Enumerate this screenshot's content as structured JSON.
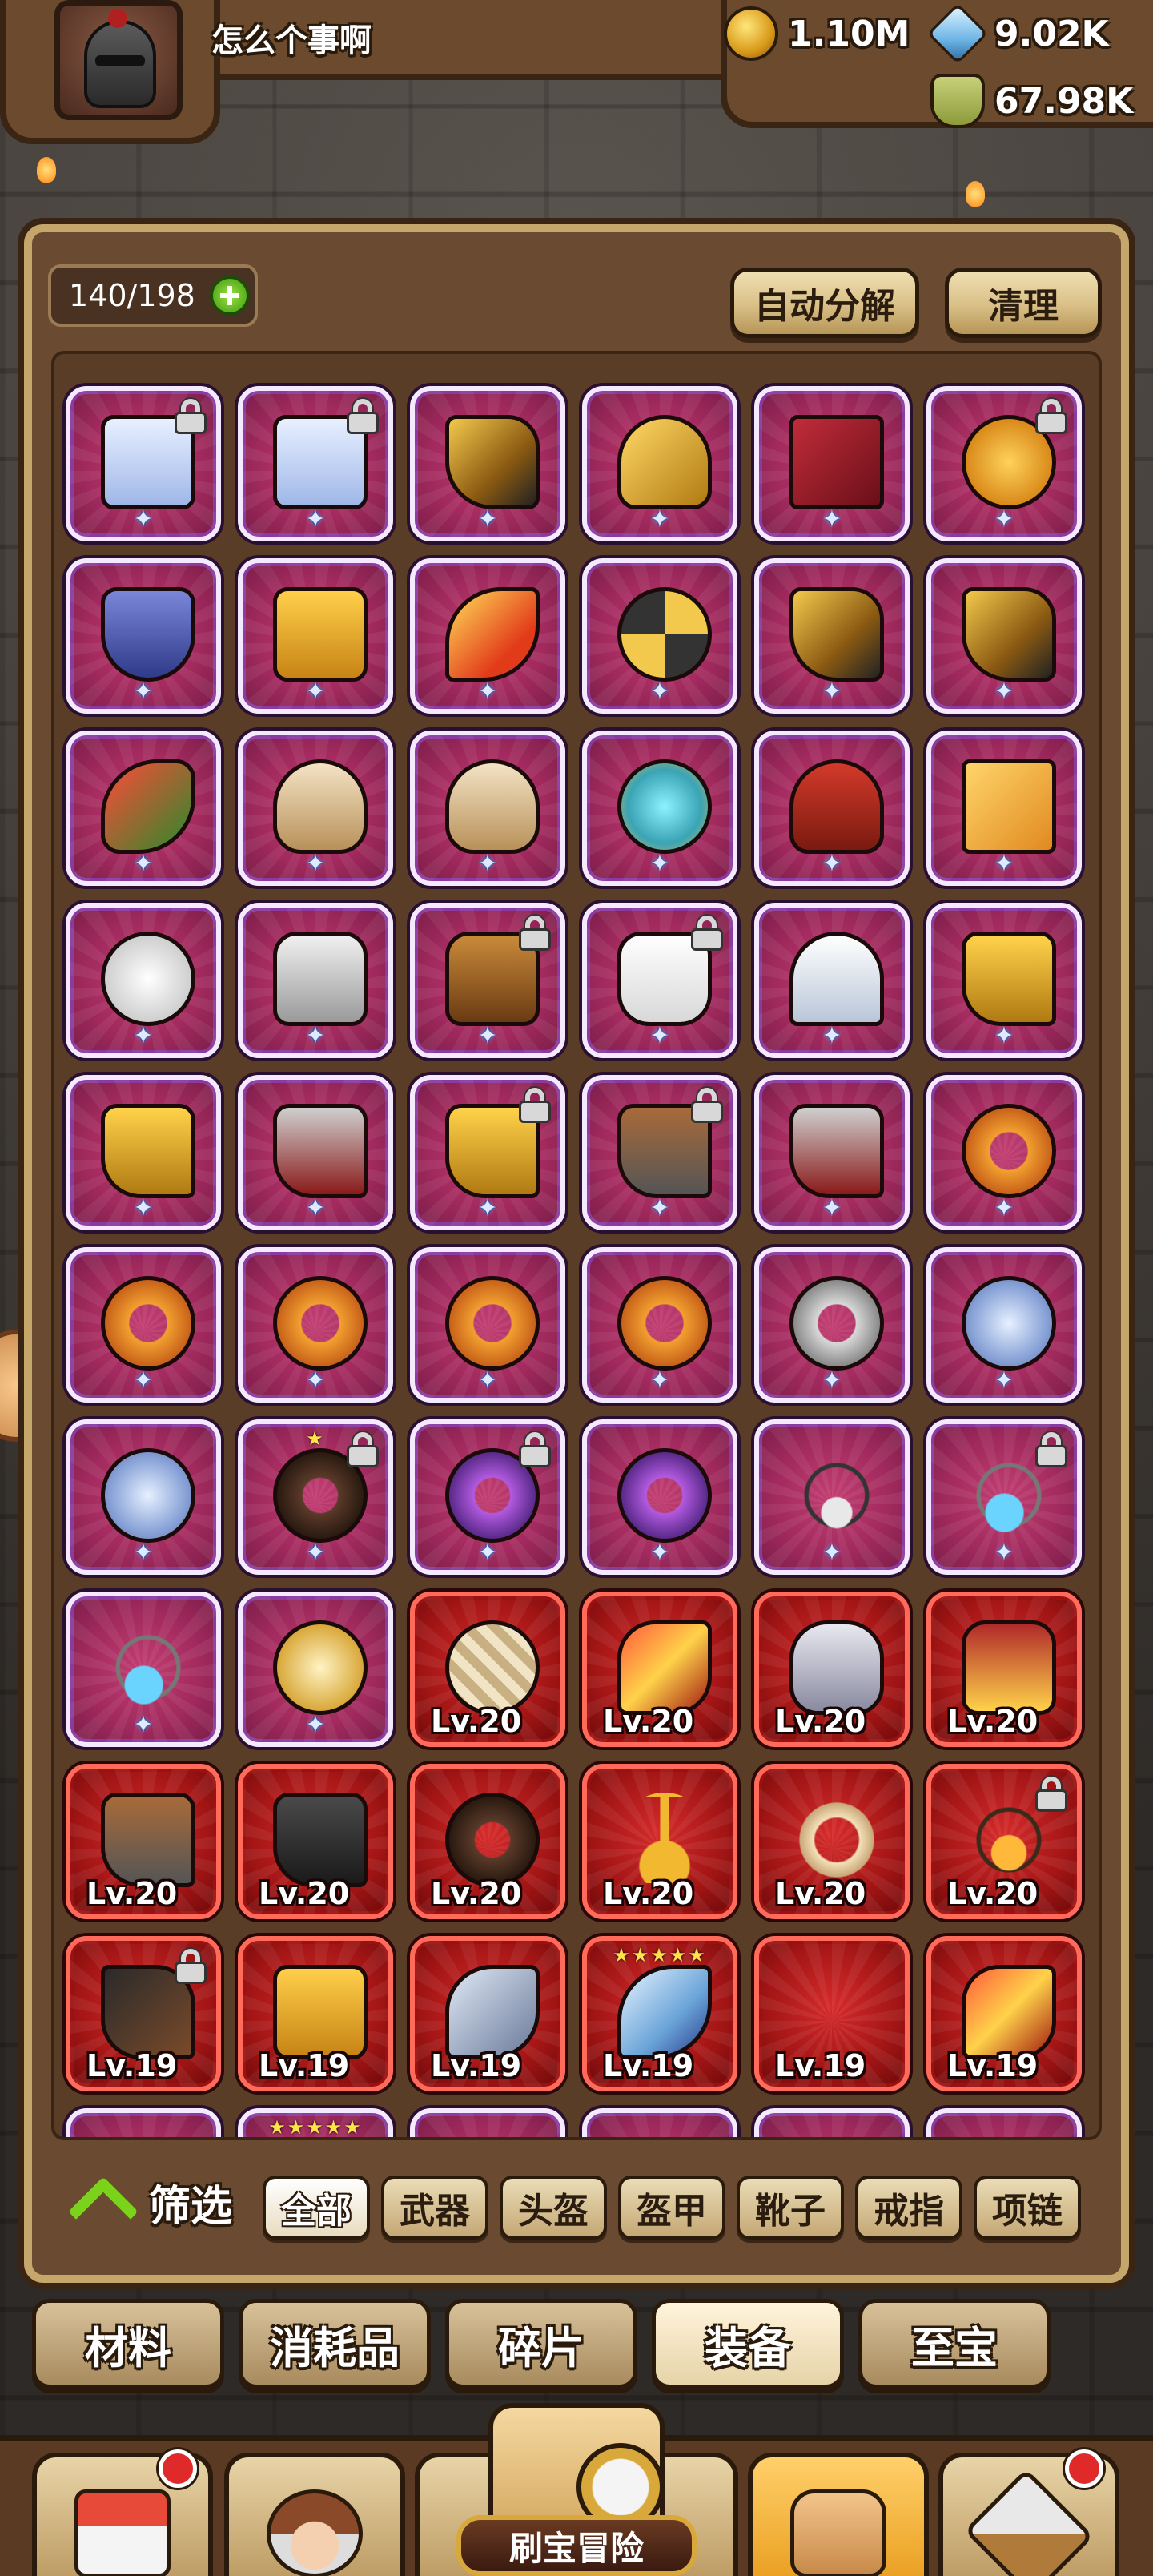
{
  "player": {
    "name": "怎么个事啊",
    "avatar_icon": "knight-helmet-icon"
  },
  "resources": [
    {
      "icon": "gold-coin-icon",
      "value": "1.10M"
    },
    {
      "icon": "diamond-icon",
      "value": "9.02K"
    },
    {
      "icon": "potion-icon",
      "value": "67.98K"
    }
  ],
  "inventory": {
    "capacity": "140/198",
    "auto_decompose_label": "自动分解",
    "clean_label": "清理",
    "items": [
      {
        "icon": "scroll-icon",
        "locked": true,
        "level": "",
        "stars": ""
      },
      {
        "icon": "scroll-icon",
        "locked": true,
        "level": "",
        "stars": ""
      },
      {
        "icon": "revolver-icon",
        "locked": false,
        "level": "",
        "stars": ""
      },
      {
        "icon": "golden-mace-icon",
        "locked": false,
        "level": "",
        "stars": ""
      },
      {
        "icon": "spellbook-icon",
        "locked": false,
        "level": "",
        "stars": ""
      },
      {
        "icon": "pizza-icon",
        "locked": true,
        "level": "",
        "stars": ""
      },
      {
        "icon": "winged-shield-icon",
        "locked": false,
        "level": "",
        "stars": ""
      },
      {
        "icon": "welding-mask-icon",
        "locked": false,
        "level": "",
        "stars": ""
      },
      {
        "icon": "flame-sword-icon",
        "locked": false,
        "level": "",
        "stars": ""
      },
      {
        "icon": "crossbow-icon",
        "locked": false,
        "level": "",
        "stars": ""
      },
      {
        "icon": "revolver-icon",
        "locked": false,
        "level": "",
        "stars": ""
      },
      {
        "icon": "revolver-icon",
        "locked": false,
        "level": "",
        "stars": ""
      },
      {
        "icon": "star-wand-icon",
        "locked": false,
        "level": "",
        "stars": ""
      },
      {
        "icon": "horn-helmet-icon",
        "locked": false,
        "level": "",
        "stars": ""
      },
      {
        "icon": "horn-helmet-icon",
        "locked": false,
        "level": "",
        "stars": ""
      },
      {
        "icon": "crystal-crown-icon",
        "locked": false,
        "level": "",
        "stars": ""
      },
      {
        "icon": "red-helmet-icon",
        "locked": false,
        "level": "",
        "stars": ""
      },
      {
        "icon": "golden-paper-icon",
        "locked": false,
        "level": "",
        "stars": ""
      },
      {
        "icon": "turban-icon",
        "locked": false,
        "level": "",
        "stars": ""
      },
      {
        "icon": "chainmail-icon",
        "locked": false,
        "level": "",
        "stars": ""
      },
      {
        "icon": "bronze-armor-icon",
        "locked": true,
        "level": "",
        "stars": ""
      },
      {
        "icon": "fur-robe-icon",
        "locked": true,
        "level": "",
        "stars": ""
      },
      {
        "icon": "white-tent-icon",
        "locked": false,
        "level": "",
        "stars": ""
      },
      {
        "icon": "golden-boot-icon",
        "locked": false,
        "level": "",
        "stars": ""
      },
      {
        "icon": "golden-boot-icon",
        "locked": false,
        "level": "",
        "stars": ""
      },
      {
        "icon": "red-boot-icon",
        "locked": false,
        "level": "",
        "stars": ""
      },
      {
        "icon": "golden-boot-icon",
        "locked": true,
        "level": "",
        "stars": ""
      },
      {
        "icon": "leather-boot-icon",
        "locked": true,
        "level": "",
        "stars": ""
      },
      {
        "icon": "red-boot-icon",
        "locked": false,
        "level": "",
        "stars": ""
      },
      {
        "icon": "ruby-ring-icon",
        "locked": false,
        "level": "",
        "stars": ""
      },
      {
        "icon": "ruby-ring-icon",
        "locked": false,
        "level": "",
        "stars": ""
      },
      {
        "icon": "ruby-ring-icon",
        "locked": false,
        "level": "",
        "stars": ""
      },
      {
        "icon": "ruby-ring-icon",
        "locked": false,
        "level": "",
        "stars": ""
      },
      {
        "icon": "golden-claw-ring-icon",
        "locked": false,
        "level": "",
        "stars": ""
      },
      {
        "icon": "silver-ring-icon",
        "locked": false,
        "level": "",
        "stars": ""
      },
      {
        "icon": "crystal-ring-icon",
        "locked": false,
        "level": "",
        "stars": ""
      },
      {
        "icon": "crystal-ring-icon",
        "locked": false,
        "level": "",
        "stars": ""
      },
      {
        "icon": "dark-claw-ring-icon",
        "locked": true,
        "level": "",
        "stars": "★"
      },
      {
        "icon": "rose-ring-icon",
        "locked": true,
        "level": "",
        "stars": ""
      },
      {
        "icon": "rose-ring-icon",
        "locked": false,
        "level": "",
        "stars": ""
      },
      {
        "icon": "wolf-tooth-necklace-icon",
        "locked": false,
        "level": "",
        "stars": ""
      },
      {
        "icon": "blue-gem-necklace-icon",
        "locked": true,
        "level": "",
        "stars": ""
      },
      {
        "icon": "blue-gem-necklace-icon",
        "locked": false,
        "level": "",
        "stars": ""
      },
      {
        "icon": "golden-compass-icon",
        "locked": false,
        "level": "",
        "stars": ""
      },
      {
        "icon": "woven-shield-icon",
        "locked": false,
        "level": "Lv.20",
        "stars": ""
      },
      {
        "icon": "golden-crossbow-icon",
        "locked": false,
        "level": "Lv.20",
        "stars": ""
      },
      {
        "icon": "wolf-helmet-icon",
        "locked": false,
        "level": "Lv.20",
        "stars": ""
      },
      {
        "icon": "royal-coat-icon",
        "locked": false,
        "level": "Lv.20",
        "stars": ""
      },
      {
        "icon": "leather-boot-icon",
        "locked": false,
        "level": "Lv.20",
        "stars": ""
      },
      {
        "icon": "dark-boot-icon",
        "locked": false,
        "level": "Lv.20",
        "stars": ""
      },
      {
        "icon": "dark-claw-ring-icon",
        "locked": false,
        "level": "Lv.20",
        "stars": ""
      },
      {
        "icon": "rope-necklace-icon",
        "locked": false,
        "level": "Lv.20",
        "stars": ""
      },
      {
        "icon": "bead-bracelet-icon",
        "locked": false,
        "level": "Lv.20",
        "stars": ""
      },
      {
        "icon": "amber-amulet-icon",
        "locked": true,
        "level": "Lv.20",
        "stars": ""
      },
      {
        "icon": "spiked-club-icon",
        "locked": true,
        "level": "Lv.19",
        "stars": ""
      },
      {
        "icon": "welding-mask-icon",
        "locked": false,
        "level": "Lv.19",
        "stars": ""
      },
      {
        "icon": "swordfish-icon",
        "locked": false,
        "level": "Lv.19",
        "stars": ""
      },
      {
        "icon": "frost-sword-icon",
        "locked": false,
        "level": "Lv.19",
        "stars": "★★★★★"
      },
      {
        "icon": "empty-icon",
        "locked": false,
        "level": "Lv.19",
        "stars": ""
      },
      {
        "icon": "golden-crossbow-icon",
        "locked": false,
        "level": "Lv.19",
        "stars": ""
      },
      {
        "icon": "item-icon",
        "locked": false,
        "level": "",
        "stars": ""
      },
      {
        "icon": "item-icon",
        "locked": false,
        "level": "",
        "stars": "★★★★★"
      },
      {
        "icon": "item-icon",
        "locked": false,
        "level": "",
        "stars": ""
      },
      {
        "icon": "item-icon",
        "locked": false,
        "level": "",
        "stars": ""
      },
      {
        "icon": "item-icon",
        "locked": false,
        "level": "",
        "stars": ""
      },
      {
        "icon": "item-icon",
        "locked": false,
        "level": "",
        "stars": ""
      }
    ]
  },
  "filter": {
    "label": "筛选",
    "options": [
      "全部",
      "武器",
      "头盔",
      "盔甲",
      "靴子",
      "戒指",
      "项链"
    ],
    "selected": "全部"
  },
  "categories": {
    "tabs": [
      "材料",
      "消耗品",
      "碎片",
      "装备",
      "至宝"
    ],
    "selected": "装备"
  },
  "bottom_nav": {
    "items": [
      {
        "icon": "shop-icon",
        "badge": true
      },
      {
        "icon": "hero-icon",
        "badge": false
      },
      {
        "icon": "map-compass-icon",
        "label": "刷宝冒险",
        "badge": false
      },
      {
        "icon": "backpack-icon",
        "badge": false,
        "active": true
      },
      {
        "icon": "forge-hammer-icon",
        "badge": true
      }
    ]
  }
}
